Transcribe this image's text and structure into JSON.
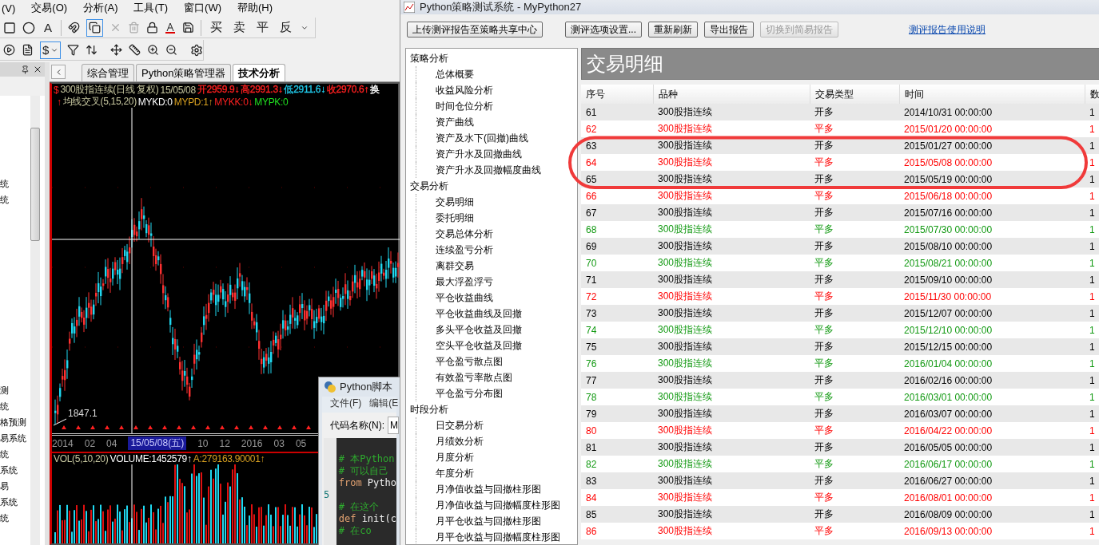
{
  "main_window": {
    "menu": [
      "(V)",
      "交易(O)",
      "分析(A)",
      "工具(T)",
      "窗口(W)",
      "帮助(H)"
    ],
    "toolbar": {
      "text_tool": "A",
      "trade_buttons": [
        "买",
        "卖",
        "平",
        "反"
      ],
      "currency": "$"
    },
    "side_panel": {
      "items_top": [
        "统",
        "统"
      ],
      "items_bottom": [
        "测",
        "统",
        "格预测",
        "易系统",
        "统",
        "系统",
        "易",
        "系统",
        "统"
      ]
    },
    "tabs": [
      {
        "label": "综合管理",
        "selected": false
      },
      {
        "label": "Python策略管理器",
        "selected": false
      },
      {
        "label": "技术分析",
        "selected": true
      }
    ],
    "chart": {
      "marker": "$",
      "title": "300股指连续(日线 复权)",
      "date": "15/05/08",
      "quotes": [
        {
          "text": "开2959.9↓",
          "color": "#ff2020"
        },
        {
          "text": "高2991.3↓",
          "color": "#ff2020"
        },
        {
          "text": "低2911.6↓",
          "color": "#20c8e8"
        },
        {
          "text": "收2970.6↑",
          "color": "#ff2020"
        },
        {
          "text": "换",
          "color": "#ffffff"
        }
      ],
      "signal_arrow": "↑",
      "indicator": "均线交叉(5,15,20)",
      "signals": [
        {
          "text": "MYKD:0",
          "color": "#ffffff"
        },
        {
          "text": "MYPD:1↑",
          "color": "#d8a020"
        },
        {
          "text": "MYKK:0↓",
          "color": "#ff2020"
        },
        {
          "text": "MYPK:0",
          "color": "#20e020"
        }
      ],
      "low_label": "1847.1",
      "axis": [
        {
          "text": "2014",
          "selected": false
        },
        {
          "text": "02",
          "selected": false
        },
        {
          "text": "04",
          "selected": false
        },
        {
          "text": "15/05/08(五)",
          "selected": true
        },
        {
          "text": "10",
          "selected": false
        },
        {
          "text": "12",
          "selected": false
        },
        {
          "text": "2016",
          "selected": false
        },
        {
          "text": "03",
          "selected": false
        },
        {
          "text": "05",
          "selected": false
        }
      ],
      "volume_title": "VOL(5,10,20)",
      "volume_values": [
        {
          "text": "VOLUME:1452579↑",
          "color": "#ffffff"
        },
        {
          "text": "A:279163.90001↑",
          "color": "#d8a020"
        }
      ]
    }
  },
  "script_window": {
    "title": "Python脚本",
    "menu": [
      "文件(F)",
      "编辑(E"
    ],
    "name_label": "代码名称(N):",
    "name_value": "M",
    "code": [
      {
        "kind": "blank"
      },
      {
        "kind": "comment",
        "text": "# 本Python"
      },
      {
        "kind": "comment",
        "text": "# 可以自己"
      },
      {
        "kind": "code",
        "keyword": "from",
        "text": " Pytho"
      },
      {
        "kind": "blank",
        "line_number": "5"
      },
      {
        "kind": "comment",
        "text": "#  在这个"
      },
      {
        "kind": "code",
        "keyword": "def",
        "text": " init(c"
      },
      {
        "kind": "comment",
        "text": "    # 在co"
      }
    ]
  },
  "report_window": {
    "title": "Python策略测试系统 - MyPython27",
    "buttons": [
      {
        "label": "上传测评报告至策略共享中心",
        "disabled": false
      },
      {
        "label": "测评选项设置...",
        "disabled": false
      },
      {
        "label": "重新刷新",
        "disabled": false
      },
      {
        "label": "导出报告",
        "disabled": false
      },
      {
        "label": "切换到简易报告",
        "disabled": true
      }
    ],
    "help_link": "测评报告使用说明",
    "tree": [
      {
        "label": "策略分析",
        "children": [
          {
            "label": "总体概要"
          },
          {
            "label": "收益风险分析"
          },
          {
            "label": "时间仓位分析"
          },
          {
            "label": "资产曲线"
          },
          {
            "label": "资产及水下(回撤)曲线"
          },
          {
            "label": "资产升水及回撤曲线"
          },
          {
            "label": "资产升水及回撤幅度曲线"
          }
        ]
      },
      {
        "label": "交易分析",
        "children": [
          {
            "label": "交易明细"
          },
          {
            "label": "委托明细"
          },
          {
            "label": "交易总体分析"
          },
          {
            "label": "连续盈亏分析"
          },
          {
            "label": "离群交易"
          },
          {
            "label": "最大浮盈浮亏"
          },
          {
            "label": "平仓收益曲线"
          },
          {
            "label": "平仓收益曲线及回撤"
          },
          {
            "label": "多头平仓收益及回撤"
          },
          {
            "label": "空头平仓收益及回撤"
          },
          {
            "label": "平仓盈亏散点图"
          },
          {
            "label": "有效盈亏率散点图"
          },
          {
            "label": "平仓盈亏分布图"
          }
        ]
      },
      {
        "label": "时段分析",
        "children": [
          {
            "label": "日交易分析"
          },
          {
            "label": "月绩效分析"
          },
          {
            "label": "月度分析"
          },
          {
            "label": "年度分析"
          },
          {
            "label": "月净值收益与回撤柱形图"
          },
          {
            "label": "月净值收益与回撤幅度柱形图"
          },
          {
            "label": "月平仓收益与回撤柱形图"
          },
          {
            "label": "月平仓收益与回撤幅度柱形图"
          }
        ]
      }
    ],
    "heading": "交易明细",
    "table": {
      "columns": [
        "序号",
        "品种",
        "交易类型",
        "时间",
        "数"
      ],
      "rows": [
        {
          "cells": [
            "61",
            "300股指连续",
            "开多",
            "2014/10/31 00:00:00",
            "1"
          ],
          "color": "#000000"
        },
        {
          "cells": [
            "62",
            "300股指连续",
            "平多",
            "2015/01/20 00:00:00",
            "1"
          ],
          "color": "#ff0000"
        },
        {
          "cells": [
            "63",
            "300股指连续",
            "开多",
            "2015/01/27 00:00:00",
            "1"
          ],
          "color": "#000000"
        },
        {
          "cells": [
            "64",
            "300股指连续",
            "平多",
            "2015/05/08 00:00:00",
            "1"
          ],
          "color": "#ff0000"
        },
        {
          "cells": [
            "65",
            "300股指连续",
            "开多",
            "2015/05/19 00:00:00",
            "1"
          ],
          "color": "#000000"
        },
        {
          "cells": [
            "66",
            "300股指连续",
            "平多",
            "2015/06/18 00:00:00",
            "1"
          ],
          "color": "#ff0000"
        },
        {
          "cells": [
            "67",
            "300股指连续",
            "开多",
            "2015/07/16 00:00:00",
            "1"
          ],
          "color": "#000000"
        },
        {
          "cells": [
            "68",
            "300股指连续",
            "平多",
            "2015/07/30 00:00:00",
            "1"
          ],
          "color": "#119911"
        },
        {
          "cells": [
            "69",
            "300股指连续",
            "开多",
            "2015/08/10 00:00:00",
            "1"
          ],
          "color": "#000000"
        },
        {
          "cells": [
            "70",
            "300股指连续",
            "平多",
            "2015/08/21 00:00:00",
            "1"
          ],
          "color": "#119911"
        },
        {
          "cells": [
            "71",
            "300股指连续",
            "开多",
            "2015/09/10 00:00:00",
            "1"
          ],
          "color": "#000000"
        },
        {
          "cells": [
            "72",
            "300股指连续",
            "平多",
            "2015/11/30 00:00:00",
            "1"
          ],
          "color": "#ff0000"
        },
        {
          "cells": [
            "73",
            "300股指连续",
            "开多",
            "2015/12/07 00:00:00",
            "1"
          ],
          "color": "#000000"
        },
        {
          "cells": [
            "74",
            "300股指连续",
            "平多",
            "2015/12/10 00:00:00",
            "1"
          ],
          "color": "#119911"
        },
        {
          "cells": [
            "75",
            "300股指连续",
            "开多",
            "2015/12/15 00:00:00",
            "1"
          ],
          "color": "#000000"
        },
        {
          "cells": [
            "76",
            "300股指连续",
            "平多",
            "2016/01/04 00:00:00",
            "1"
          ],
          "color": "#119911"
        },
        {
          "cells": [
            "77",
            "300股指连续",
            "开多",
            "2016/02/16 00:00:00",
            "1"
          ],
          "color": "#000000"
        },
        {
          "cells": [
            "78",
            "300股指连续",
            "平多",
            "2016/03/01 00:00:00",
            "1"
          ],
          "color": "#119911"
        },
        {
          "cells": [
            "79",
            "300股指连续",
            "开多",
            "2016/03/07 00:00:00",
            "1"
          ],
          "color": "#000000"
        },
        {
          "cells": [
            "80",
            "300股指连续",
            "平多",
            "2016/04/22 00:00:00",
            "1"
          ],
          "color": "#ff0000"
        },
        {
          "cells": [
            "81",
            "300股指连续",
            "开多",
            "2016/05/05 00:00:00",
            "1"
          ],
          "color": "#000000"
        },
        {
          "cells": [
            "82",
            "300股指连续",
            "平多",
            "2016/06/17 00:00:00",
            "1"
          ],
          "color": "#119911"
        },
        {
          "cells": [
            "83",
            "300股指连续",
            "开多",
            "2016/06/27 00:00:00",
            "1"
          ],
          "color": "#000000"
        },
        {
          "cells": [
            "84",
            "300股指连续",
            "平多",
            "2016/08/01 00:00:00",
            "1"
          ],
          "color": "#ff0000"
        },
        {
          "cells": [
            "85",
            "300股指连续",
            "开多",
            "2016/08/09 00:00:00",
            "1"
          ],
          "color": "#000000"
        },
        {
          "cells": [
            "86",
            "300股指连续",
            "平多",
            "2016/09/13 00:00:00",
            "1"
          ],
          "color": "#ff0000"
        }
      ]
    }
  }
}
